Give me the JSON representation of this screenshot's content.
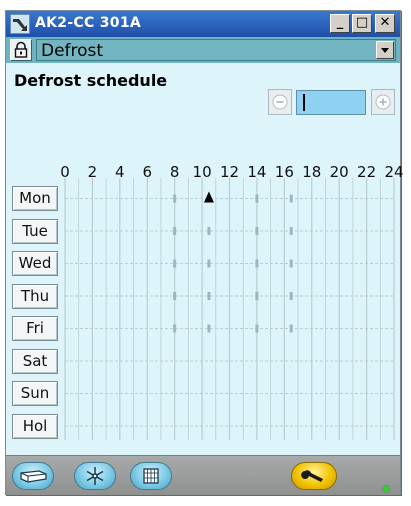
{
  "window": {
    "title": "AK2-CC 301A",
    "controls": {
      "minimize": "_",
      "maximize": "□",
      "close": "✕"
    }
  },
  "section": {
    "selected": "Defrost",
    "lock_icon": "padlock-icon",
    "dropdown_icon": "chevron-down-icon"
  },
  "heading": "Defrost schedule",
  "navigation": {
    "prev_label": "-",
    "next_label": "+"
  },
  "schedule": {
    "hour_labels": [
      "0",
      "2",
      "4",
      "6",
      "8",
      "10",
      "12",
      "14",
      "16",
      "18",
      "20",
      "22",
      "24"
    ],
    "days": [
      "Mon",
      "Tue",
      "Wed",
      "Thu",
      "Fri",
      "Sat",
      "Sun",
      "Hol"
    ],
    "defrost_marks_hours": [
      8,
      10.5,
      14,
      16.5
    ],
    "marked_days": [
      "Mon",
      "Tue",
      "Wed",
      "Thu",
      "Fri"
    ],
    "cursor": {
      "day": "Mon",
      "hour": 10.5
    }
  },
  "toolbar": {
    "buttons": [
      "cabinet-icon",
      "snowflake-icon",
      "calendar-icon",
      "wrench-icon"
    ]
  },
  "colors": {
    "panel": "#ddf5fa",
    "titlebar": "#1f4fa8",
    "sectionbar": "#6fb3bf",
    "grid": "#b7cdd2",
    "mark": "#9ab7be",
    "status_led": "#27d62c"
  }
}
